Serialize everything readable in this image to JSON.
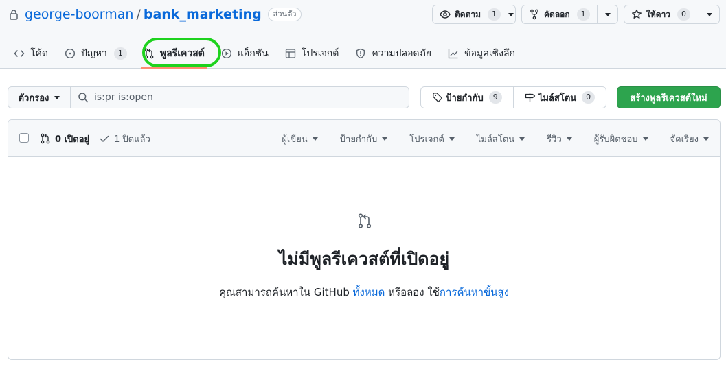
{
  "repo": {
    "owner": "george-boorman",
    "separator": "/",
    "name": "bank_marketing",
    "visibility": "ส่วนตัว"
  },
  "actions": {
    "watch": {
      "label": "ติดตาม",
      "count": "1"
    },
    "fork": {
      "label": "คัดลอก",
      "count": "1"
    },
    "star": {
      "label": "ให้ดาว",
      "count": "0"
    }
  },
  "tabs": [
    {
      "label": "โค้ด",
      "icon": "code-icon"
    },
    {
      "label": "ปัญหา",
      "icon": "issue-opened-icon",
      "count": "1"
    },
    {
      "label": "พูลรีเควสต์",
      "icon": "git-pull-request-icon",
      "selected": true
    },
    {
      "label": "แอ็กชัน",
      "icon": "play-icon"
    },
    {
      "label": "โปรเจกต์",
      "icon": "table-icon"
    },
    {
      "label": "ความปลอดภัย",
      "icon": "shield-icon"
    },
    {
      "label": "ข้อมูลเชิงลึก",
      "icon": "graph-icon"
    }
  ],
  "subnav": {
    "filters_label": "ตัวกรอง",
    "search_value": "is:pr is:open",
    "labels_label": "ป้ายกำกับ",
    "labels_count": "9",
    "milestones_label": "ไมล์สโตน",
    "milestones_count": "0",
    "new_pr_label": "สร้างพูลรีเควสต์ใหม่"
  },
  "list_header": {
    "open_label": "0 เปิดอยู่",
    "closed_label": "1 ปิดแล้ว",
    "sorts": [
      "ผู้เขียน",
      "ป้ายกำกับ",
      "โปรเจกต์",
      "ไมล์สโตน",
      "รีวิว",
      "ผู้รับผิดชอบ",
      "จัดเรียง"
    ]
  },
  "blankslate": {
    "title": "ไม่มีพูลรีเควสต์ที่เปิดอยู่",
    "desc_prefix": "คุณสามารถค้นหาใน GitHub ",
    "link_all": "ทั้งหมด",
    "desc_middle": " หรือลอง ใช้",
    "link_advanced": "การค้นหาขั้นสูง"
  },
  "colors": {
    "accent_link": "#0969da",
    "primary_button": "#2da44e",
    "selected_tab_underline": "#fd8c73",
    "highlight_ring": "#1ed21e"
  }
}
